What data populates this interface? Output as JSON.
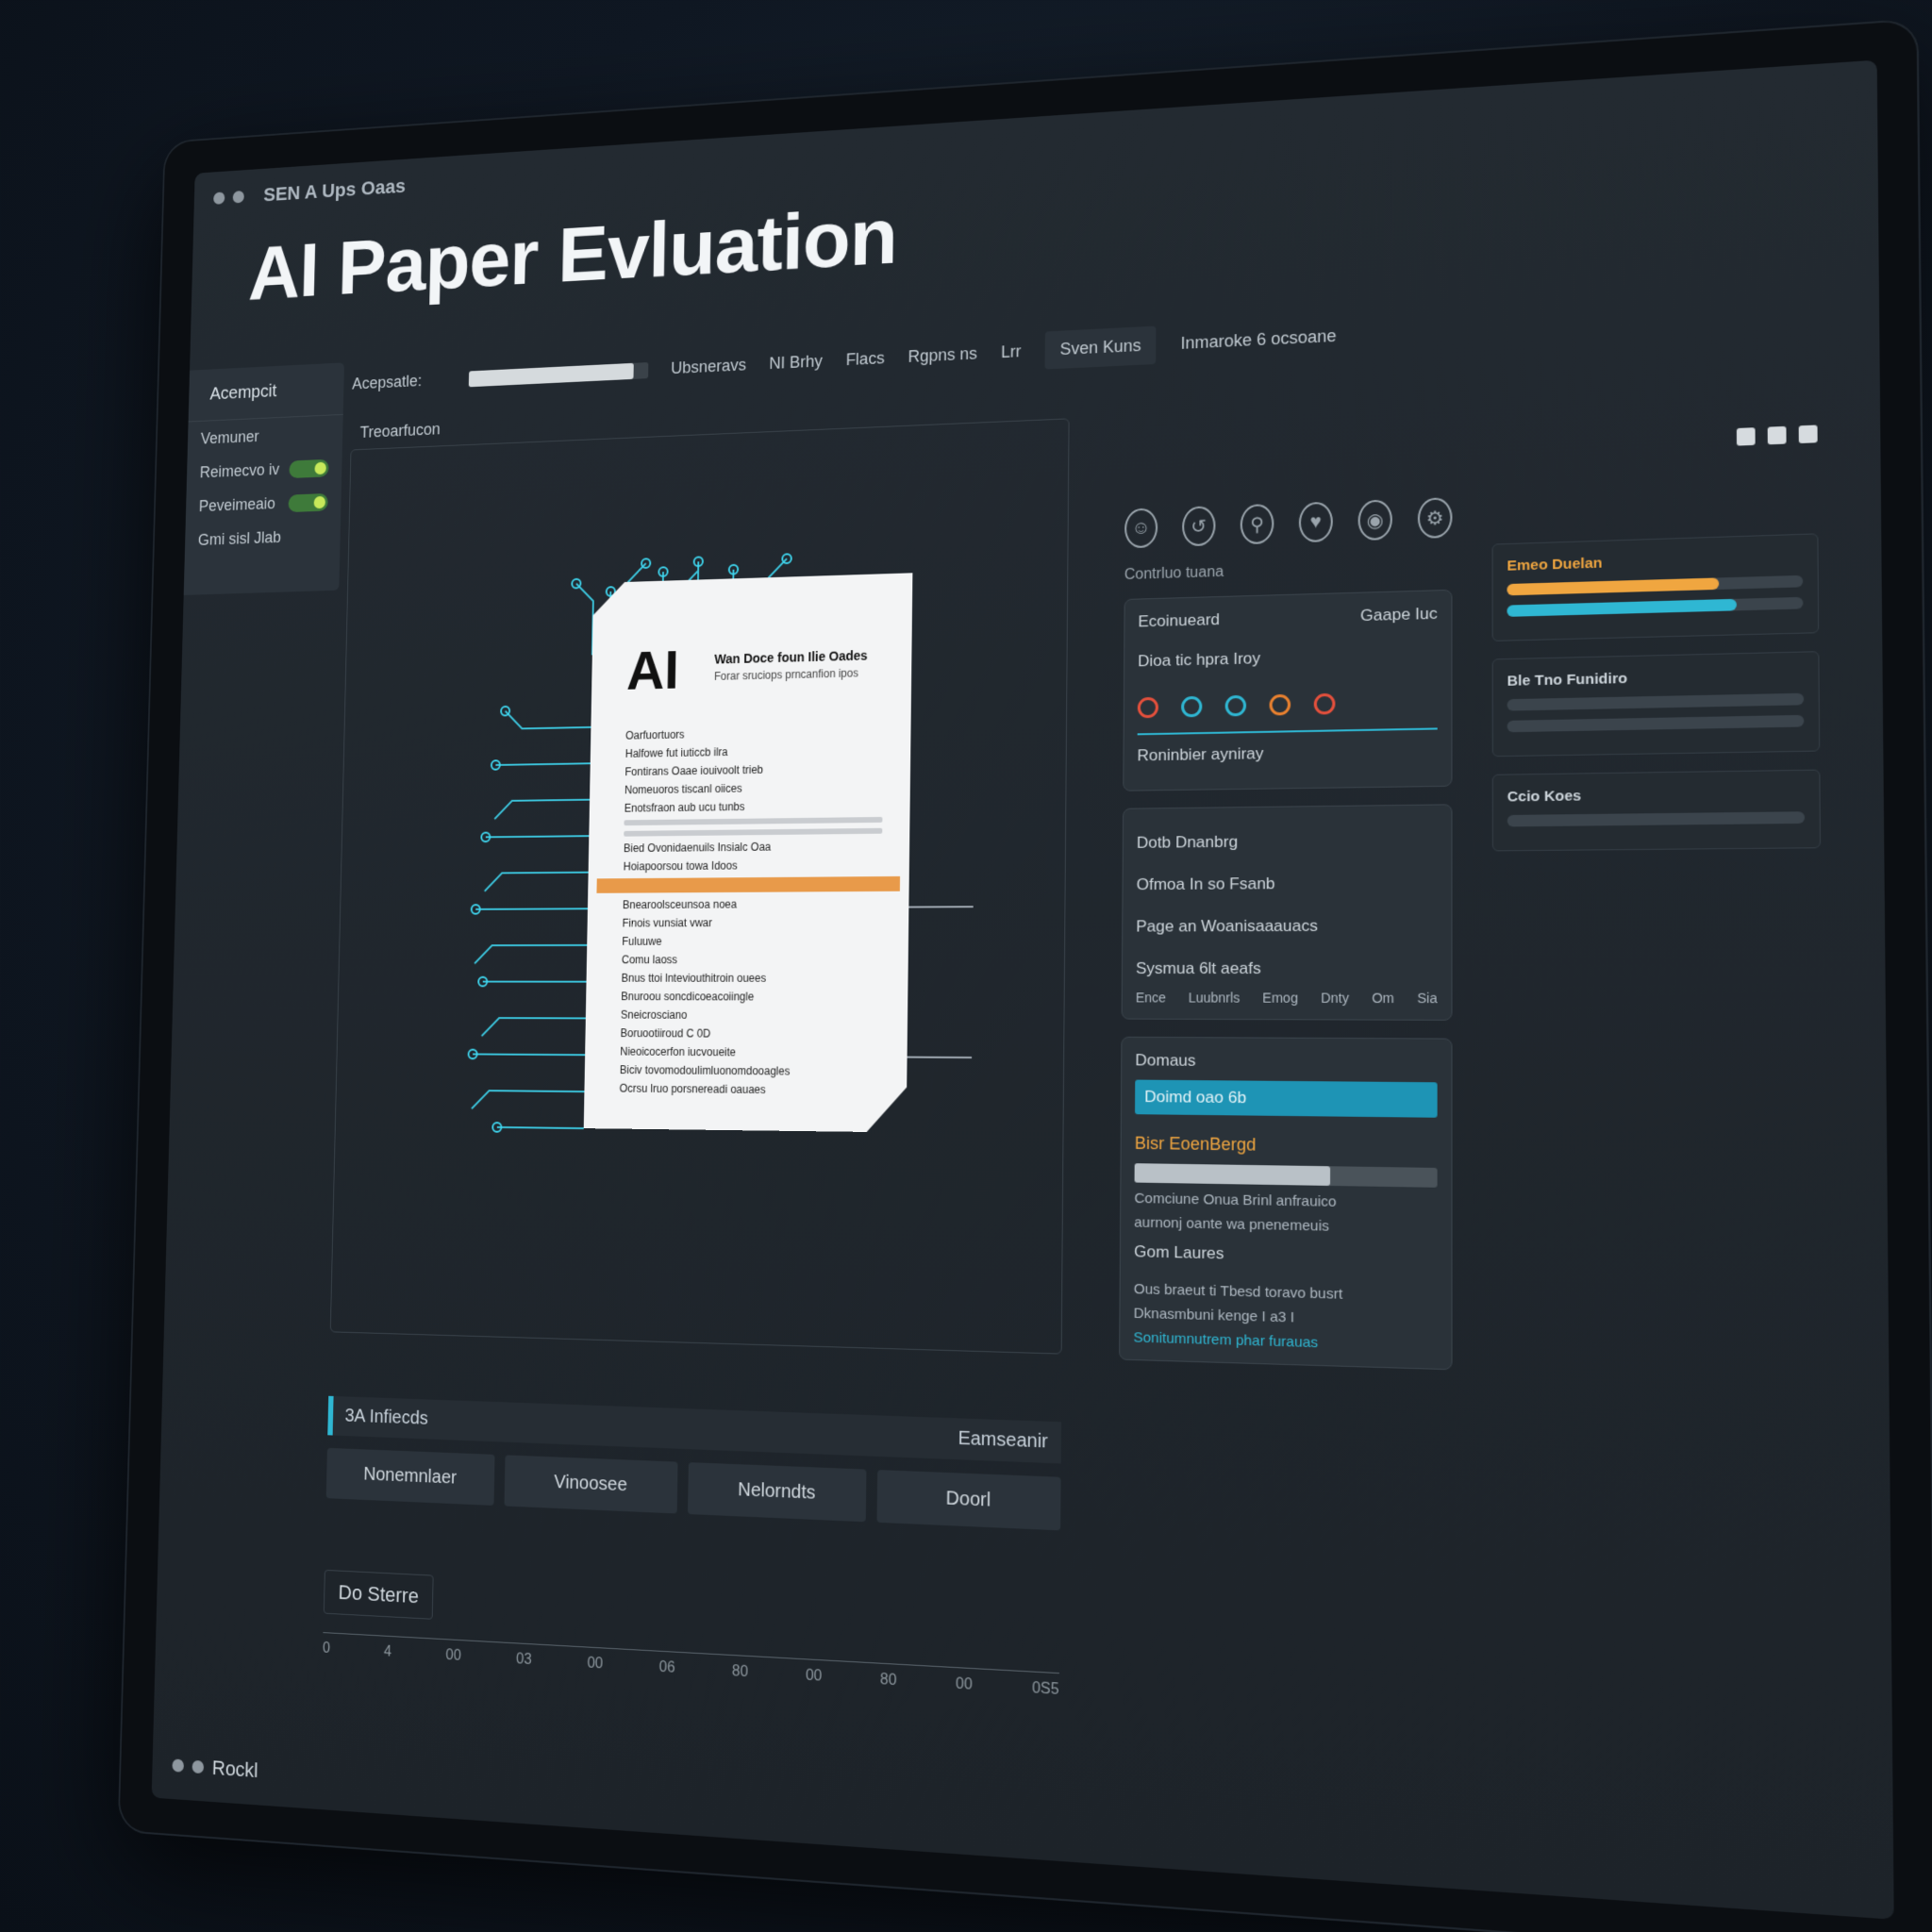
{
  "titlebar": {
    "app_name": "SEN A Ups Oaas"
  },
  "page": {
    "heading": "AI Paper Evluation"
  },
  "left_nav": {
    "header": "Acempcit",
    "items": [
      {
        "label": "Vemuner",
        "toggle": false
      },
      {
        "label": "Reimecvo iv",
        "toggle": true
      },
      {
        "label": "Peveimeaio",
        "toggle": true
      },
      {
        "label": "Gmi sisl Jlab",
        "toggle": false
      }
    ]
  },
  "toolbar": {
    "label": "Acepsatle:",
    "field_progress": 0.92,
    "status": "Ubsneravs",
    "item2": "NI Brhy",
    "item3": "Flacs",
    "item4": "Rgpns ns",
    "item5": "Lrr",
    "tab": "Sven Kuns",
    "tab2": "Inmaroke 6 ocsoane"
  },
  "main_panel": {
    "title": "Treoarfucon",
    "paper": {
      "ai": "AI",
      "title": "Wan Doce foun Ilie Oades",
      "subtitle": "Forar sruciops prncanfion ipos",
      "lines": [
        "Oarfuortuors",
        "Halfowe fut iuticcb ilra",
        "Fontirans Oaae iouivoolt trieb",
        "Nomeuoros tiscanl oiices",
        "Enotsfraon aub ucu tunbs",
        "Bied Ovonidaenuils Insialc Oaa",
        "Hoiapoorsou towa Idoos",
        "Bnearoolsceunsoa noea",
        "Finois vunsiat vwar",
        "Fuluuwe",
        "Comu laoss",
        "Bnus ttoi lnteviouthitroin ouees",
        "Bnuroou soncdicoeacoiingle",
        "Sneicrosciano",
        "Boruootiiroud C 0D",
        "Nieoicocerfon iucvoueite",
        "Biciv tovomodoulimluonomdooagles",
        "Ocrsu lruo porsnereadi oauaes"
      ]
    }
  },
  "ribbon": {
    "row1_left": "3A Infiecds",
    "row1_right": "Eamseanir",
    "tabs": [
      "Nonemnlaer",
      "Vinoosee",
      "Nelorndts",
      "Doorl"
    ]
  },
  "axis": {
    "label": "Do Sterre",
    "ticks": [
      "0",
      "4",
      "00",
      "03",
      "00",
      "06",
      "80",
      "00",
      "80",
      "00",
      "0S5"
    ]
  },
  "right_col": {
    "icons": [
      "user-icon",
      "arrow-icon",
      "shield-icon",
      "heart-icon",
      "lock-icon",
      "gear-icon"
    ],
    "caption": "Contrluo tuana",
    "card1": {
      "header": "Ecoinueard",
      "header_right": "Gaape Iuc",
      "sub": "Dioa tic hpra Iroy",
      "bottom": "Roninbier ayniray"
    },
    "card2_lines": [
      "Dotb Dnanbrg",
      "Ofmoa In so Fsanb",
      "Page an Woanisaaauacs",
      "Sysmua 6lt aeafs"
    ],
    "card2_row": [
      "Ence",
      "Luubnrls",
      "Emog",
      "Dnty",
      "Om",
      "Sia"
    ],
    "card3": {
      "header": "Domaus",
      "cyan_label": "Doimd oao 6b",
      "orange": "Bisr EoenBergd",
      "bar_progress": 0.65,
      "desc1": "Comciune Onua Brinl anfrauico",
      "desc2": "aurnonj oante wa pnenemeuis",
      "gen": "Gom Laures",
      "l1": "Ous braeut ti Tbesd toravo busrt",
      "l2": "Dknasmbuni kenge I a3 I",
      "l3": "Sonitumnutrem phar furauas"
    }
  },
  "far_col": {
    "card1_title": "Emeo Duelan",
    "bar1": 0.72,
    "bar2": 0.78,
    "card2_title": "Ble Tno Funidiro",
    "card3_title": "Ccio Koes",
    "colors": {
      "orange": "#f0a640",
      "cyan": "#2fb7d3",
      "blue": "#3f6fd9"
    }
  },
  "footer": {
    "label": "Rockl"
  }
}
